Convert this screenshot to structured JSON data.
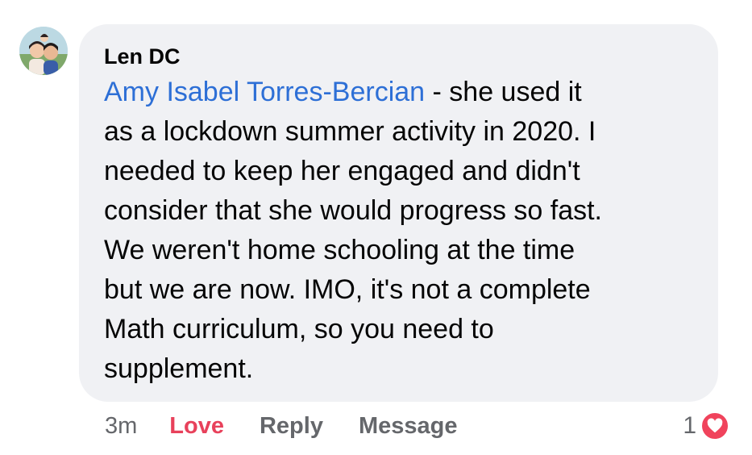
{
  "comment": {
    "author": "Len DC",
    "mention": "Amy Isabel Torres-Bercian",
    "text_lines": [
      " - she used it",
      "as a lockdown summer activity in 2020. I",
      "needed to keep her engaged and didn't",
      "consider that she would progress so fast.",
      "We weren't home schooling at the time",
      "but we are now. IMO, it's not a complete",
      "Math curriculum, so you need to",
      "supplement."
    ],
    "avatar_icon": "profile-photo",
    "bubble_color": "#f0f1f4",
    "mention_color": "#2d6fd6"
  },
  "actions": {
    "timestamp": "3m",
    "love_label": "Love",
    "reply_label": "Reply",
    "message_label": "Message",
    "love_color": "#e8415b"
  },
  "reactions": {
    "count": "1",
    "icon": "heart-icon",
    "badge_color": "#f0435c"
  }
}
